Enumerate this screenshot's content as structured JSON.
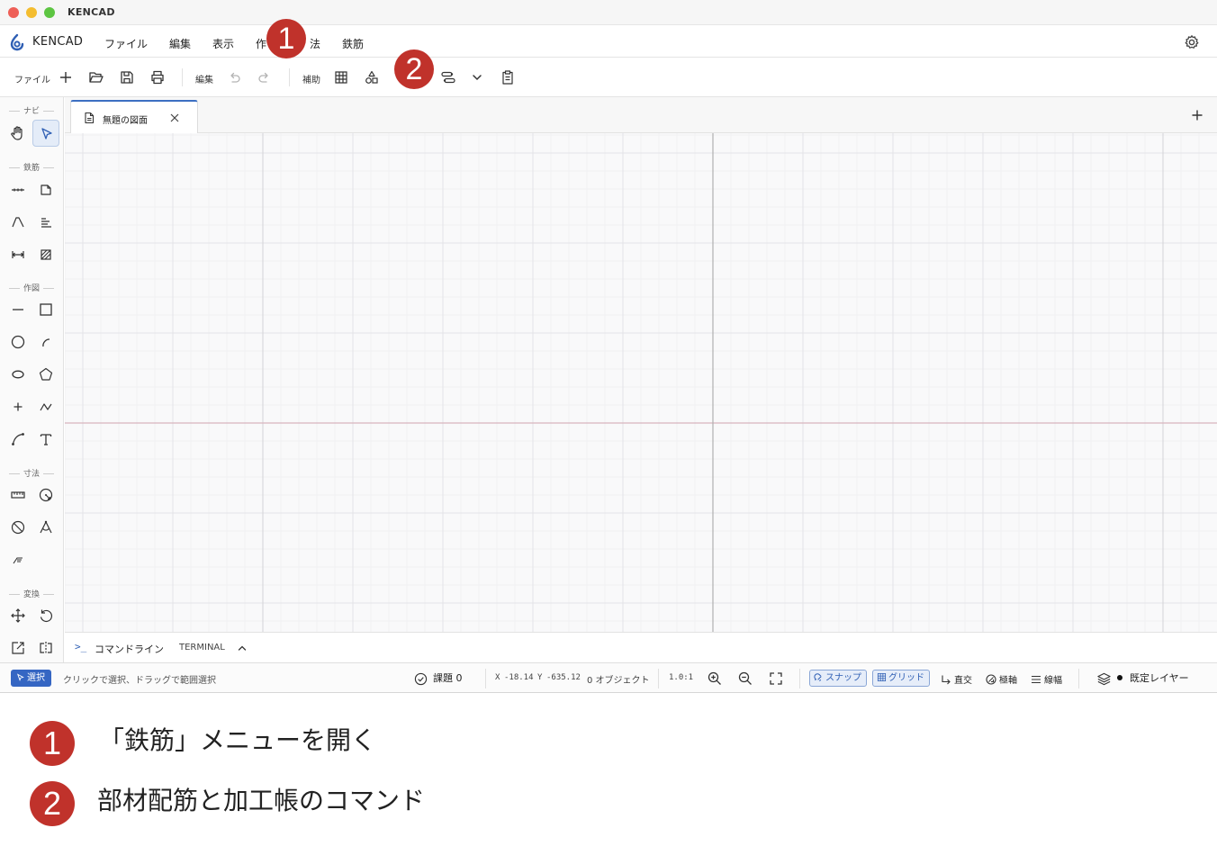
{
  "window": {
    "title": "KENCAD"
  },
  "menubar": {
    "app_name": "KENCAD",
    "items": [
      "ファイル",
      "編集",
      "表示",
      "作",
      "法",
      "鉄筋"
    ]
  },
  "toolbar": {
    "file_label": "ファイル",
    "edit_label": "編集",
    "assist_label": "補助",
    "file_tools": [
      "plus-icon",
      "folder-open-icon",
      "save-icon",
      "print-icon"
    ],
    "edit_tools": [
      "undo-icon",
      "redo-icon"
    ],
    "assist_tools": [
      "grid-icon",
      "shapes-icon",
      "bar-settings-icon",
      "chevron-down-icon",
      "clipboard-icon"
    ]
  },
  "palette": {
    "categories": {
      "nav": "ナビ",
      "rebar": "鉄筋",
      "draw": "作図",
      "dimension": "寸法",
      "transform": "変換"
    }
  },
  "tabs": {
    "items": [
      {
        "label": "無題の図面"
      }
    ]
  },
  "command_line": {
    "prompt": ">_",
    "title": "コマンドライン",
    "terminal": "TERMINAL"
  },
  "statusbar": {
    "mode": "選択",
    "hint": "クリックで選択、ドラッグで範囲選択",
    "issues": "課題 0",
    "x_label": "X",
    "x": "-18.14",
    "y_label": "Y",
    "y": "-635.12",
    "objects": "0 オブジェクト",
    "scale": "1.0:1",
    "snap": "スナップ",
    "grid": "グリッド",
    "ortho": "直交",
    "polar": "極軸",
    "lineweight": "線幅",
    "layer": "既定レイヤー"
  },
  "annotations": {
    "marker1": "1",
    "marker2": "2",
    "note1": "「鉄筋」メニューを開く",
    "note2": "部材配筋と加工帳のコマンド"
  },
  "colors": {
    "accent": "#3566c3",
    "marker": "#c0322b",
    "axis_x": "#d8b4be",
    "axis_y": "#b0b0b0"
  }
}
